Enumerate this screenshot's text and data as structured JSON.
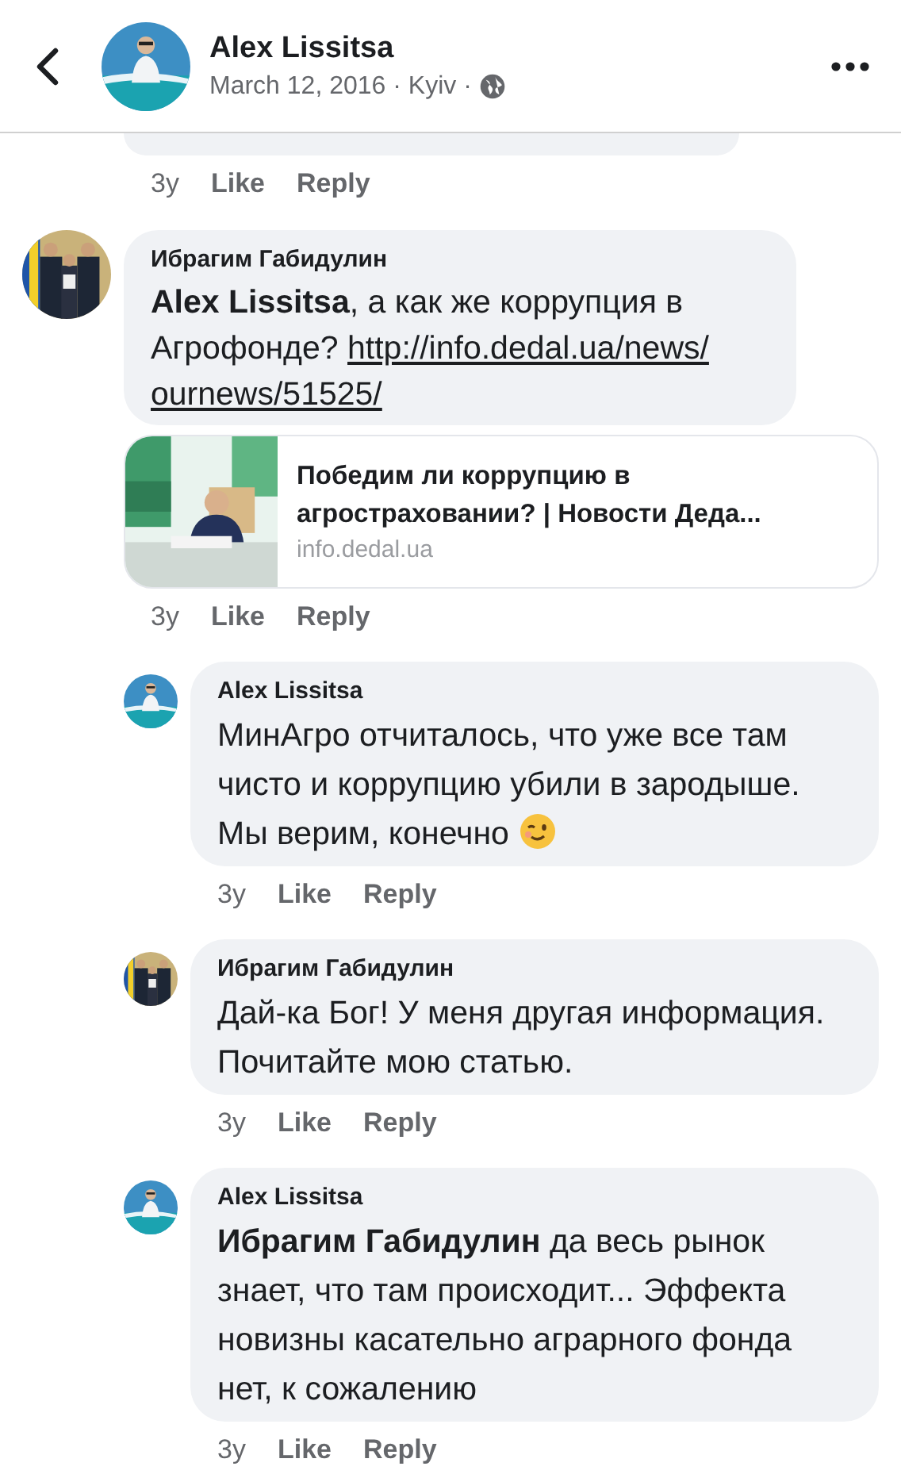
{
  "header": {
    "name": "Alex Lissitsa",
    "meta": "March 12, 2016 · Kyiv ·"
  },
  "comments": [
    {
      "kind": "cut",
      "actions": {
        "time": "3y",
        "like": "Like",
        "reply": "Reply"
      }
    },
    {
      "kind": "comment",
      "author": "Ибрагим Габидулин",
      "text": "**Alex Lissitsa**, а как же коррупция в Агрофонде?",
      "link_lines": [
        "http://info.dedal.ua/news/",
        "ournews/51525/"
      ],
      "preview": {
        "title": "Победим ли коррупцию в агростраховании? | Новости Деда...",
        "domain": "info.dedal.ua"
      },
      "actions": {
        "time": "3y",
        "like": "Like",
        "reply": "Reply"
      },
      "children": [
        {
          "kind": "comment",
          "author": "Alex Lissitsa",
          "text": "МинАгро отчиталось, что уже все там чисто и коррупцию убили в зародыше. Мы верим, конечно",
          "emoji": true,
          "actions": {
            "time": "3y",
            "like": "Like",
            "reply": "Reply"
          }
        },
        {
          "kind": "comment",
          "author": "Ибрагим Габидулин",
          "text": "Дай-ка Бог! У меня другая информация. Почитайте мою статью.",
          "actions": {
            "time": "3y",
            "like": "Like",
            "reply": "Reply"
          }
        },
        {
          "kind": "comment",
          "author": "Alex Lissitsa",
          "text": "**Ибрагим Габидулин** да весь рынок знает, что там происходит... Эффекта новизны касательно аграрного фонда нет, к сожалению",
          "actions": {
            "time": "3y",
            "like": "Like",
            "reply": "Reply"
          }
        }
      ]
    }
  ]
}
